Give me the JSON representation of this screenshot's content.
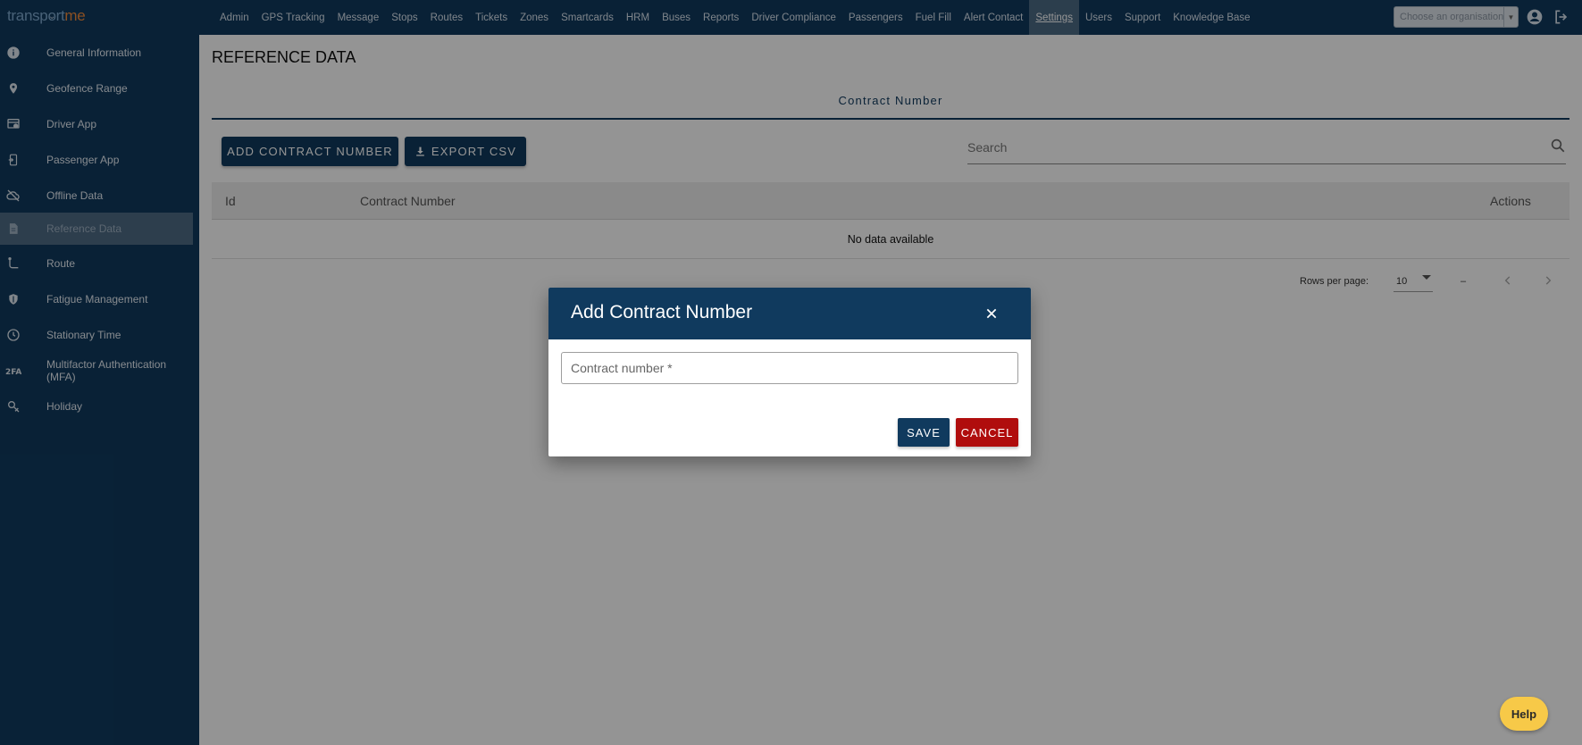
{
  "app": {
    "logo_part1": "transport",
    "logo_part2": "me"
  },
  "topnav": {
    "items": [
      {
        "label": "Admin"
      },
      {
        "label": "GPS Tracking"
      },
      {
        "label": "Message"
      },
      {
        "label": "Stops"
      },
      {
        "label": "Routes"
      },
      {
        "label": "Tickets"
      },
      {
        "label": "Zones"
      },
      {
        "label": "Smartcards"
      },
      {
        "label": "HRM"
      },
      {
        "label": "Buses"
      },
      {
        "label": "Reports"
      },
      {
        "label": "Driver Compliance"
      },
      {
        "label": "Passengers"
      },
      {
        "label": "Fuel Fill"
      },
      {
        "label": "Alert Contact"
      },
      {
        "label": "Settings"
      },
      {
        "label": "Users"
      },
      {
        "label": "Support"
      },
      {
        "label": "Knowledge Base"
      }
    ],
    "active": "Settings",
    "org_select_placeholder": "Choose an organisation",
    "icons": [
      "account-circle-icon",
      "logout-icon"
    ]
  },
  "sidebar": {
    "items": [
      {
        "label": "General Information",
        "icon": "info-icon"
      },
      {
        "label": "Geofence Range",
        "icon": "map-pin-icon"
      },
      {
        "label": "Driver App",
        "icon": "driver-app-icon"
      },
      {
        "label": "Passenger App",
        "icon": "passenger-app-icon"
      },
      {
        "label": "Offline Data",
        "icon": "cloud-off-icon"
      },
      {
        "label": "Reference Data",
        "icon": "document-icon"
      },
      {
        "label": "Route",
        "icon": "route-icon"
      },
      {
        "label": "Fatigue Management",
        "icon": "shield-icon"
      },
      {
        "label": "Stationary Time",
        "icon": "clock-icon"
      },
      {
        "label": "Multifactor Authentication (MFA)",
        "icon": "2fa-icon"
      },
      {
        "label": "Holiday",
        "icon": "holiday-icon"
      }
    ],
    "active": "Reference Data"
  },
  "main": {
    "title": "REFERENCE DATA",
    "tab_label": "Contract Number",
    "add_button": "Add Contract Number",
    "export_button": "Export CSV",
    "search_placeholder": "Search",
    "table": {
      "columns": [
        "Id",
        "Contract Number",
        "Actions"
      ],
      "empty_text": "No data available"
    },
    "pagination": {
      "rows_per_page_label": "Rows per page:",
      "rows_per_page_value": "10",
      "range_text": "–"
    }
  },
  "dialog": {
    "title": "Add Contract Number",
    "field_placeholder": "Contract number *",
    "save_label": "Save",
    "cancel_label": "Cancel"
  },
  "help": {
    "label": "Help"
  },
  "colors": {
    "primary": "#103a5e",
    "danger": "#b00d0d",
    "help": "#f7c948",
    "logo_accent": "#f08a3c"
  }
}
